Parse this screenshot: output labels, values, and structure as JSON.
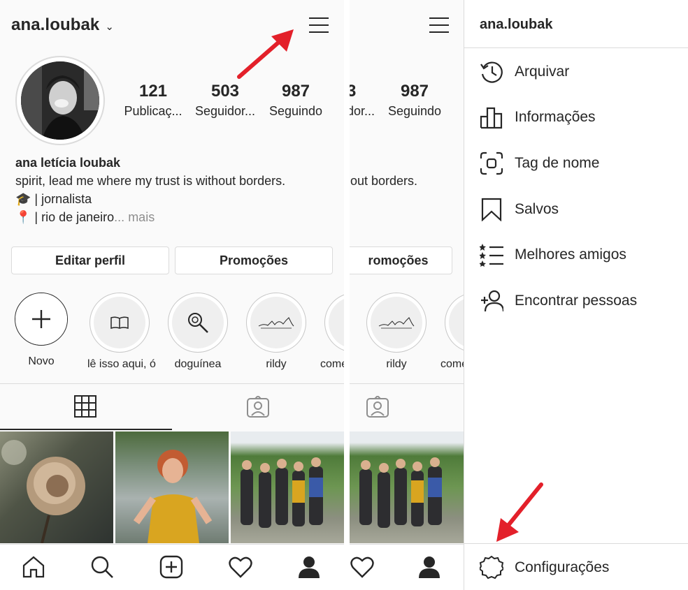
{
  "profile": {
    "username": "ana.loubak",
    "stats": [
      {
        "value": "121",
        "label": "Publicaç..."
      },
      {
        "value": "503",
        "label": "Seguidor..."
      },
      {
        "value": "987",
        "label": "Seguindo"
      }
    ],
    "bio": {
      "name": "ana letícia loubak",
      "line1": "spirit, lead me where my trust is without borders.",
      "line2": "🎓 | jornalista",
      "line3": "📍 | rio de janeiro",
      "ellipsis": "...",
      "more": "mais"
    },
    "buttons": {
      "edit": "Editar perfil",
      "promotions": "Promoções"
    },
    "highlights": [
      {
        "label": "Novo",
        "icon": "plus-icon"
      },
      {
        "label": "lê isso aqui, ó",
        "icon": "book-icon"
      },
      {
        "label": "doguínea",
        "icon": "magnifier-icon"
      },
      {
        "label": "rildy",
        "icon": "landscape-sketch-icon"
      },
      {
        "label": "come",
        "icon": "landscape-sketch-icon"
      }
    ]
  },
  "middle": {
    "stats": [
      {
        "value": "3",
        "label": "dor..."
      },
      {
        "value": "987",
        "label": "Seguindo"
      }
    ],
    "bio_fragment": "out borders.",
    "promo_fragment": "romoções",
    "highlights": [
      {
        "label": "rildy"
      },
      {
        "label": "come"
      }
    ]
  },
  "drawer": {
    "username": "ana.loubak",
    "items": [
      {
        "label": "Arquivar",
        "icon": "archive-history-icon"
      },
      {
        "label": "Informações",
        "icon": "insights-bar-chart-icon"
      },
      {
        "label": "Tag de nome",
        "icon": "nametag-icon"
      },
      {
        "label": "Salvos",
        "icon": "bookmark-icon"
      },
      {
        "label": "Melhores amigos",
        "icon": "close-friends-list-icon"
      },
      {
        "label": "Encontrar pessoas",
        "icon": "add-person-icon"
      }
    ],
    "settings": {
      "label": "Configurações",
      "icon": "gear-icon"
    }
  },
  "colors": {
    "arrow": "#e3202a",
    "text": "#262626",
    "muted": "#8e8e8e",
    "border": "#dbdbdb"
  }
}
